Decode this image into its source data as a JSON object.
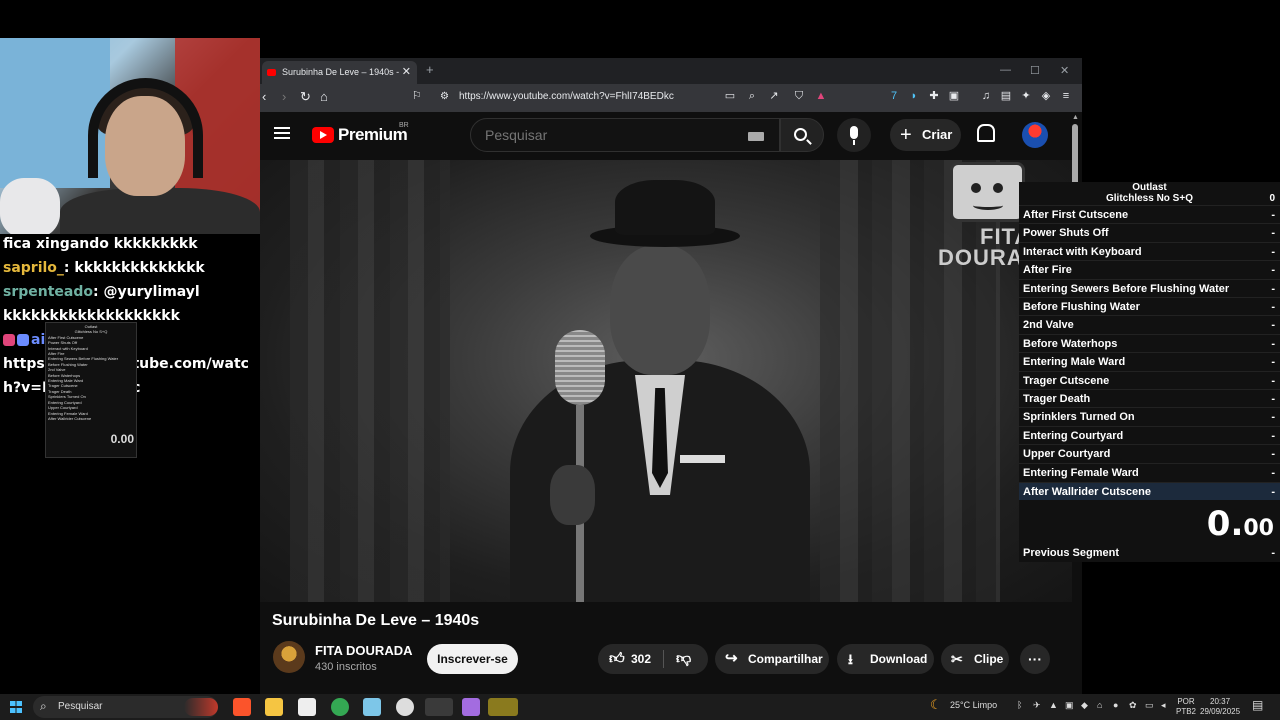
{
  "chat": {
    "lines": [
      {
        "user": "",
        "text": "fica xingando kkkkkkkkk"
      },
      {
        "user": "saprilo_",
        "text": ": kkkkkkkkkkkkkk"
      },
      {
        "user": "srpenteado",
        "text": ": @yurylimayl"
      },
      {
        "user": "",
        "text": "kkkkkkkkkkkkkkkkkkk"
      },
      {
        "user": "",
        "text": "ai"
      },
      {
        "user": "",
        "text": "https://www.youtube.com/watc"
      },
      {
        "user": "",
        "text": "h?v=FhlI74BEDkc"
      }
    ]
  },
  "browser": {
    "tab_title": "Surubinha De Leve – 1940s -",
    "url": "https://www.youtube.com/watch?v=FhlI74BEDkc"
  },
  "youtube": {
    "brand": "Premium",
    "country": "BR",
    "search_placeholder": "Pesquisar",
    "create_label": "Criar",
    "video_title": "Surubinha De Leve – 1940s",
    "watermark_line1": "FITA",
    "watermark_line2": "DOURA",
    "channel_name": "FITA DOURADA",
    "subscribers": "430 inscritos",
    "subscribe_label": "Inscrever-se",
    "likes": "302",
    "share_label": "Compartilhar",
    "download_label": "Download",
    "clip_label": "Clipe",
    "more_label": "···"
  },
  "splits": {
    "game": "Outlast",
    "category": "Glitchless No S+Q",
    "attempts": "0",
    "rows": [
      {
        "name": "After First Cutscene",
        "delta": "-"
      },
      {
        "name": "Power Shuts Off",
        "delta": "-"
      },
      {
        "name": "Interact with Keyboard",
        "delta": "-"
      },
      {
        "name": "After Fire",
        "delta": "-"
      },
      {
        "name": "Entering Sewers Before Flushing Water",
        "delta": "-"
      },
      {
        "name": "Before Flushing Water",
        "delta": "-"
      },
      {
        "name": "2nd Valve",
        "delta": "-"
      },
      {
        "name": "Before Waterhops",
        "delta": "-"
      },
      {
        "name": "Entering Male Ward",
        "delta": "-"
      },
      {
        "name": "Trager Cutscene",
        "delta": "-"
      },
      {
        "name": "Trager Death",
        "delta": "-"
      },
      {
        "name": "Sprinklers Turned On",
        "delta": "-"
      },
      {
        "name": "Entering Courtyard",
        "delta": "-"
      },
      {
        "name": "Upper Courtyard",
        "delta": "-"
      },
      {
        "name": "Entering Female Ward",
        "delta": "-"
      },
      {
        "name": "After Wallrider Cutscene",
        "delta": "-"
      }
    ],
    "timer_main": "0.",
    "timer_ms": "00",
    "previous_segment_label": "Previous Segment",
    "previous_segment_value": "-"
  },
  "taskbar": {
    "search_label": "Pesquisar",
    "weather": "25°C  Limpo",
    "lang1": "POR",
    "lang2": "PTB2",
    "time": "20:37",
    "date": "29/09/2025"
  }
}
